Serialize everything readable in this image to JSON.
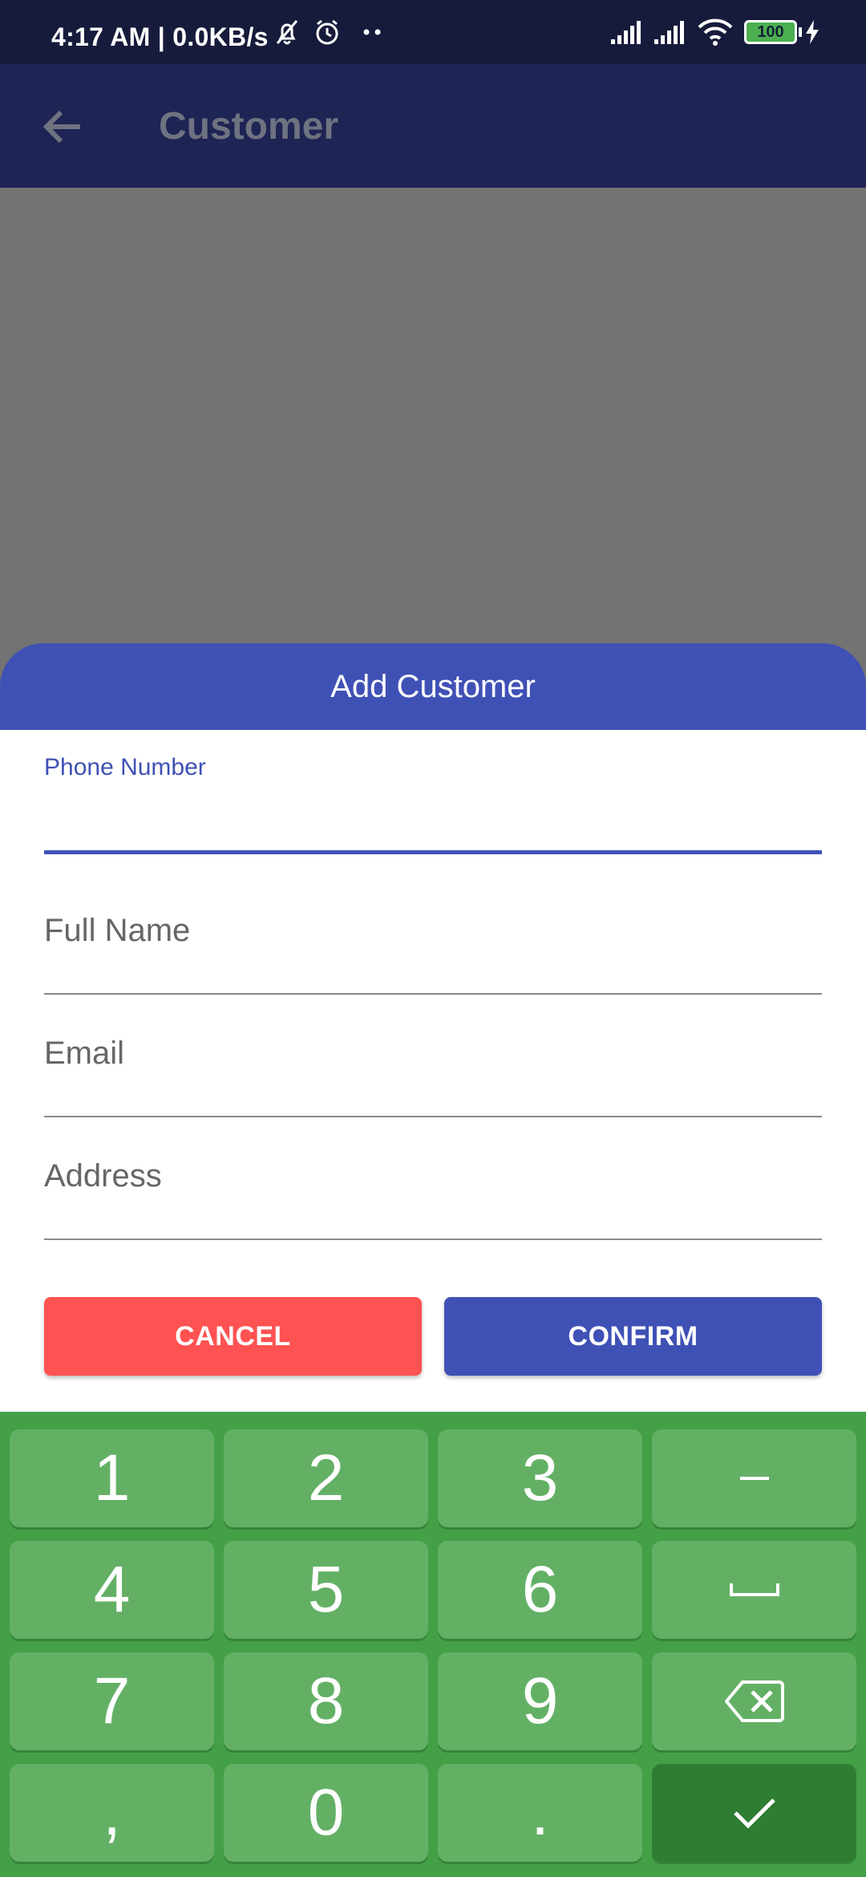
{
  "status_bar": {
    "time_speed": "4:17 AM | 0.0KB/s",
    "battery": "100"
  },
  "app_bar": {
    "title": "Customer"
  },
  "dialog": {
    "title": "Add Customer",
    "fields": {
      "phone_label": "Phone Number",
      "full_name_placeholder": "Full Name",
      "email_placeholder": "Email",
      "address_placeholder": "Address"
    },
    "cancel_label": "CANCEL",
    "confirm_label": "CONFIRM"
  },
  "keypad": {
    "keys": [
      "1",
      "2",
      "3",
      "–",
      "4",
      "5",
      "6",
      "␣",
      "7",
      "8",
      "9",
      "⌫",
      ",",
      "0",
      ".",
      "✓"
    ]
  },
  "colors": {
    "primary": "#3f51b5",
    "cancel": "#ff5252",
    "keypad_bg": "#43a047",
    "key": "#63b065",
    "key_done": "#2e7d32"
  }
}
